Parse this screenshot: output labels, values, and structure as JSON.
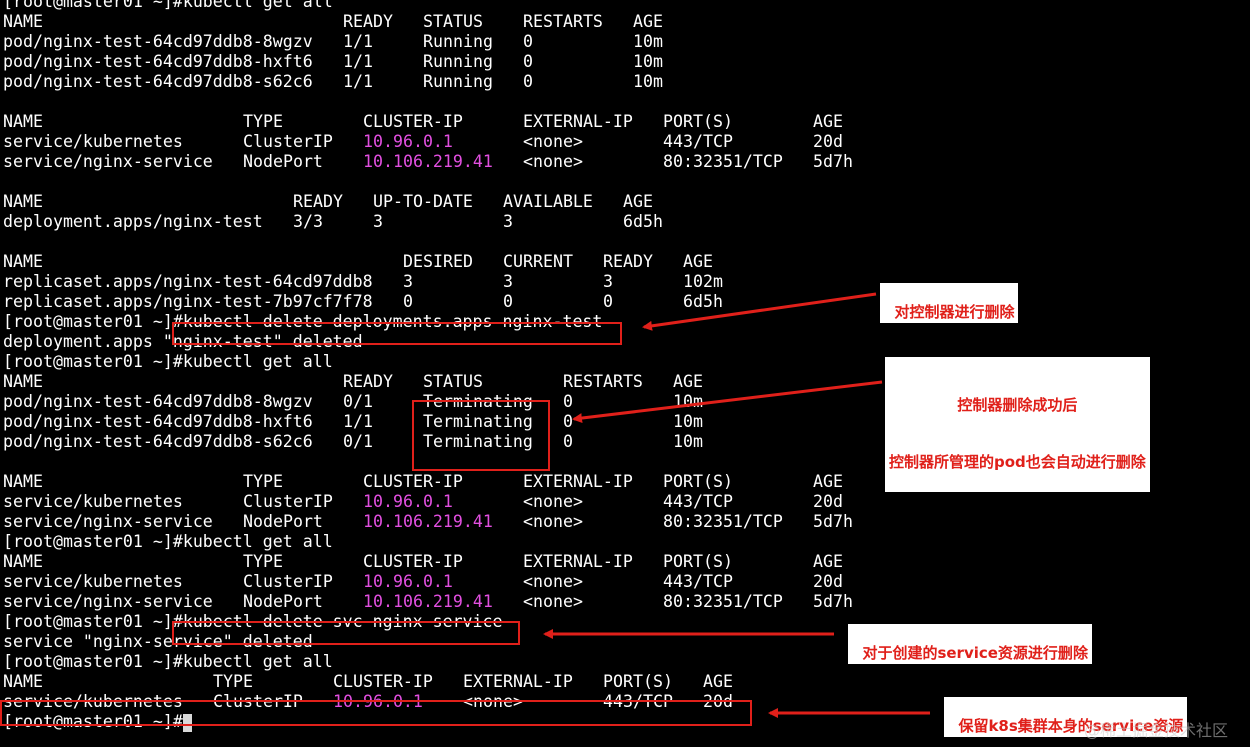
{
  "colors": {
    "background": "#000000",
    "text": "#ffffff",
    "ip": "#e24fe0",
    "annotation": "#e0201a"
  },
  "terminal": {
    "lines": [
      [
        {
          "t": "[root@master01 ~]#kubectl get all",
          "c": 0
        }
      ],
      [
        {
          "t": "NAME",
          "c": 0
        },
        {
          "t": "READY",
          "c": 34
        },
        {
          "t": "STATUS",
          "c": 42
        },
        {
          "t": "RESTARTS",
          "c": 52
        },
        {
          "t": "AGE",
          "c": 63
        }
      ],
      [
        {
          "t": "pod/nginx-test-64cd97ddb8-8wgzv",
          "c": 0
        },
        {
          "t": "1/1",
          "c": 34
        },
        {
          "t": "Running",
          "c": 42
        },
        {
          "t": "0",
          "c": 52
        },
        {
          "t": "10m",
          "c": 63
        }
      ],
      [
        {
          "t": "pod/nginx-test-64cd97ddb8-hxft6",
          "c": 0
        },
        {
          "t": "1/1",
          "c": 34
        },
        {
          "t": "Running",
          "c": 42
        },
        {
          "t": "0",
          "c": 52
        },
        {
          "t": "10m",
          "c": 63
        }
      ],
      [
        {
          "t": "pod/nginx-test-64cd97ddb8-s62c6",
          "c": 0
        },
        {
          "t": "1/1",
          "c": 34
        },
        {
          "t": "Running",
          "c": 42
        },
        {
          "t": "0",
          "c": 52
        },
        {
          "t": "10m",
          "c": 63
        }
      ],
      [],
      [
        {
          "t": "NAME",
          "c": 0
        },
        {
          "t": "TYPE",
          "c": 24
        },
        {
          "t": "CLUSTER-IP",
          "c": 36
        },
        {
          "t": "EXTERNAL-IP",
          "c": 52
        },
        {
          "t": "PORT(S)",
          "c": 66
        },
        {
          "t": "AGE",
          "c": 81
        }
      ],
      [
        {
          "t": "service/kubernetes",
          "c": 0
        },
        {
          "t": "ClusterIP",
          "c": 24
        },
        {
          "t": "10.96.0.1",
          "c": 36,
          "ip": true
        },
        {
          "t": "<none>",
          "c": 52
        },
        {
          "t": "443/TCP",
          "c": 66
        },
        {
          "t": "20d",
          "c": 81
        }
      ],
      [
        {
          "t": "service/nginx-service",
          "c": 0
        },
        {
          "t": "NodePort",
          "c": 24
        },
        {
          "t": "10.106.219.41",
          "c": 36,
          "ip": true
        },
        {
          "t": "<none>",
          "c": 52
        },
        {
          "t": "80:32351/TCP",
          "c": 66
        },
        {
          "t": "5d7h",
          "c": 81
        }
      ],
      [],
      [
        {
          "t": "NAME",
          "c": 0
        },
        {
          "t": "READY",
          "c": 29
        },
        {
          "t": "UP-TO-DATE",
          "c": 37
        },
        {
          "t": "AVAILABLE",
          "c": 50
        },
        {
          "t": "AGE",
          "c": 62
        }
      ],
      [
        {
          "t": "deployment.apps/nginx-test",
          "c": 0
        },
        {
          "t": "3/3",
          "c": 29
        },
        {
          "t": "3",
          "c": 37
        },
        {
          "t": "3",
          "c": 50
        },
        {
          "t": "6d5h",
          "c": 62
        }
      ],
      [],
      [
        {
          "t": "NAME",
          "c": 0
        },
        {
          "t": "DESIRED",
          "c": 40
        },
        {
          "t": "CURRENT",
          "c": 50
        },
        {
          "t": "READY",
          "c": 60
        },
        {
          "t": "AGE",
          "c": 68
        }
      ],
      [
        {
          "t": "replicaset.apps/nginx-test-64cd97ddb8",
          "c": 0
        },
        {
          "t": "3",
          "c": 40
        },
        {
          "t": "3",
          "c": 50
        },
        {
          "t": "3",
          "c": 60
        },
        {
          "t": "102m",
          "c": 68
        }
      ],
      [
        {
          "t": "replicaset.apps/nginx-test-7b97cf7f78",
          "c": 0
        },
        {
          "t": "0",
          "c": 40
        },
        {
          "t": "0",
          "c": 50
        },
        {
          "t": "0",
          "c": 60
        },
        {
          "t": "6d5h",
          "c": 68
        }
      ],
      [
        {
          "t": "[root@master01 ~]#kubectl delete deployments.apps nginx-test",
          "c": 0
        }
      ],
      [
        {
          "t": "deployment.apps \"nginx-test\" deleted",
          "c": 0
        }
      ],
      [
        {
          "t": "[root@master01 ~]#kubectl get all",
          "c": 0
        }
      ],
      [
        {
          "t": "NAME",
          "c": 0
        },
        {
          "t": "READY",
          "c": 34
        },
        {
          "t": "STATUS",
          "c": 42
        },
        {
          "t": "RESTARTS",
          "c": 56
        },
        {
          "t": "AGE",
          "c": 67
        }
      ],
      [
        {
          "t": "pod/nginx-test-64cd97ddb8-8wgzv",
          "c": 0
        },
        {
          "t": "0/1",
          "c": 34
        },
        {
          "t": "Terminating",
          "c": 42
        },
        {
          "t": "0",
          "c": 56
        },
        {
          "t": "10m",
          "c": 67
        }
      ],
      [
        {
          "t": "pod/nginx-test-64cd97ddb8-hxft6",
          "c": 0
        },
        {
          "t": "1/1",
          "c": 34
        },
        {
          "t": "Terminating",
          "c": 42
        },
        {
          "t": "0",
          "c": 56
        },
        {
          "t": "10m",
          "c": 67
        }
      ],
      [
        {
          "t": "pod/nginx-test-64cd97ddb8-s62c6",
          "c": 0
        },
        {
          "t": "0/1",
          "c": 34
        },
        {
          "t": "Terminating",
          "c": 42
        },
        {
          "t": "0",
          "c": 56
        },
        {
          "t": "10m",
          "c": 67
        }
      ],
      [],
      [
        {
          "t": "NAME",
          "c": 0
        },
        {
          "t": "TYPE",
          "c": 24
        },
        {
          "t": "CLUSTER-IP",
          "c": 36
        },
        {
          "t": "EXTERNAL-IP",
          "c": 52
        },
        {
          "t": "PORT(S)",
          "c": 66
        },
        {
          "t": "AGE",
          "c": 81
        }
      ],
      [
        {
          "t": "service/kubernetes",
          "c": 0
        },
        {
          "t": "ClusterIP",
          "c": 24
        },
        {
          "t": "10.96.0.1",
          "c": 36,
          "ip": true
        },
        {
          "t": "<none>",
          "c": 52
        },
        {
          "t": "443/TCP",
          "c": 66
        },
        {
          "t": "20d",
          "c": 81
        }
      ],
      [
        {
          "t": "service/nginx-service",
          "c": 0
        },
        {
          "t": "NodePort",
          "c": 24
        },
        {
          "t": "10.106.219.41",
          "c": 36,
          "ip": true
        },
        {
          "t": "<none>",
          "c": 52
        },
        {
          "t": "80:32351/TCP",
          "c": 66
        },
        {
          "t": "5d7h",
          "c": 81
        }
      ],
      [
        {
          "t": "[root@master01 ~]#kubectl get all",
          "c": 0
        }
      ],
      [
        {
          "t": "NAME",
          "c": 0
        },
        {
          "t": "TYPE",
          "c": 24
        },
        {
          "t": "CLUSTER-IP",
          "c": 36
        },
        {
          "t": "EXTERNAL-IP",
          "c": 52
        },
        {
          "t": "PORT(S)",
          "c": 66
        },
        {
          "t": "AGE",
          "c": 81
        }
      ],
      [
        {
          "t": "service/kubernetes",
          "c": 0
        },
        {
          "t": "ClusterIP",
          "c": 24
        },
        {
          "t": "10.96.0.1",
          "c": 36,
          "ip": true
        },
        {
          "t": "<none>",
          "c": 52
        },
        {
          "t": "443/TCP",
          "c": 66
        },
        {
          "t": "20d",
          "c": 81
        }
      ],
      [
        {
          "t": "service/nginx-service",
          "c": 0
        },
        {
          "t": "NodePort",
          "c": 24
        },
        {
          "t": "10.106.219.41",
          "c": 36,
          "ip": true
        },
        {
          "t": "<none>",
          "c": 52
        },
        {
          "t": "80:32351/TCP",
          "c": 66
        },
        {
          "t": "5d7h",
          "c": 81
        }
      ],
      [
        {
          "t": "[root@master01 ~]#kubectl delete svc nginx-service",
          "c": 0
        }
      ],
      [
        {
          "t": "service \"nginx-service\" deleted",
          "c": 0
        }
      ],
      [
        {
          "t": "[root@master01 ~]#kubectl get all",
          "c": 0
        }
      ],
      [
        {
          "t": "NAME",
          "c": 0
        },
        {
          "t": "TYPE",
          "c": 21
        },
        {
          "t": "CLUSTER-IP",
          "c": 33
        },
        {
          "t": "EXTERNAL-IP",
          "c": 46
        },
        {
          "t": "PORT(S)",
          "c": 60
        },
        {
          "t": "AGE",
          "c": 70
        }
      ],
      [
        {
          "t": "service/kubernetes",
          "c": 0
        },
        {
          "t": "ClusterIP",
          "c": 21
        },
        {
          "t": "10.96.0.1",
          "c": 33,
          "ip": true
        },
        {
          "t": "<none>",
          "c": 46
        },
        {
          "t": "443/TCP",
          "c": 60
        },
        {
          "t": "20d",
          "c": 70
        }
      ],
      [
        {
          "t": "[root@master01 ~]#",
          "c": 0
        }
      ]
    ]
  },
  "annotations": {
    "delete_controller": "对控制器进行删除",
    "controller_deleted_line1": "控制器删除成功后",
    "controller_deleted_line2": "控制器所管理的pod也会自动进行删除",
    "delete_service": "对于创建的service资源进行删除",
    "keep_service": "保留k8s集群本身的service资源"
  },
  "watermark": "@稀土掘金技术社区"
}
